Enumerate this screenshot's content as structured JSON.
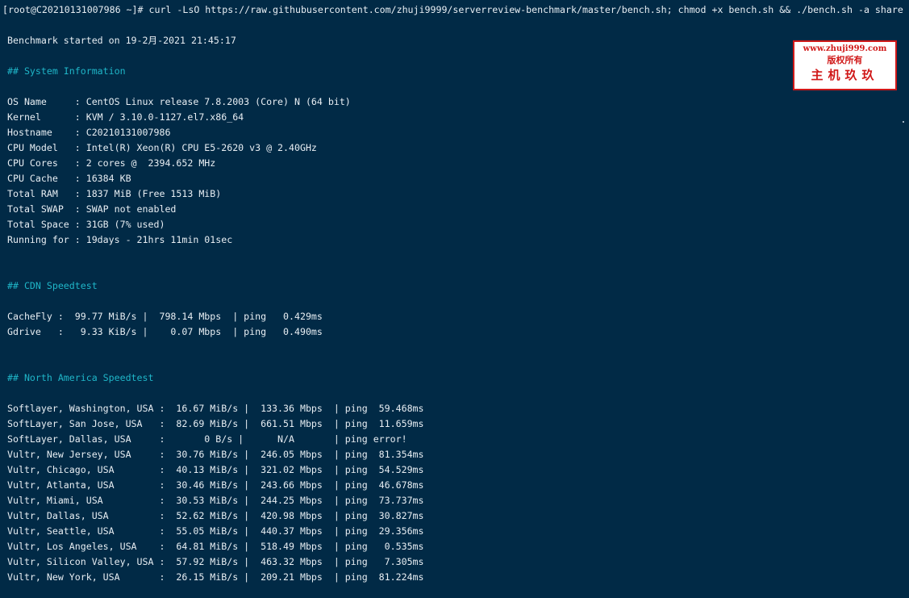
{
  "command": "[root@C20210131007986 ~]# curl -LsO https://raw.githubusercontent.com/zhuji9999/serverreview-benchmark/master/bench.sh; chmod +x bench.sh && ./bench.sh -a share",
  "started": "Benchmark started on 19-2月-2021 21:45:17",
  "sections": {
    "system": "## System Information",
    "cdn": "## CDN Speedtest",
    "na": "## North America Speedtest"
  },
  "system_info": [
    "OS Name     : CentOS Linux release 7.8.2003 (Core) N (64 bit)",
    "Kernel      : KVM / 3.10.0-1127.el7.x86_64",
    "Hostname    : C20210131007986",
    "CPU Model   : Intel(R) Xeon(R) CPU E5-2620 v3 @ 2.40GHz",
    "CPU Cores   : 2 cores @  2394.652 MHz",
    "CPU Cache   : 16384 KB",
    "Total RAM   : 1837 MiB (Free 1513 MiB)",
    "Total SWAP  : SWAP not enabled",
    "Total Space : 31GB (7% used)",
    "Running for : 19days - 21hrs 11min 01sec"
  ],
  "cdn_rows": [
    "CacheFly :  99.77 MiB/s |  798.14 Mbps  | ping   0.429ms",
    "Gdrive   :   9.33 KiB/s |    0.07 Mbps  | ping   0.490ms"
  ],
  "na_rows": [
    "Softlayer, Washington, USA :  16.67 MiB/s |  133.36 Mbps  | ping  59.468ms",
    "SoftLayer, San Jose, USA   :  82.69 MiB/s |  661.51 Mbps  | ping  11.659ms",
    "SoftLayer, Dallas, USA     :       0 B/s |      N/A       | ping error!",
    "Vultr, New Jersey, USA     :  30.76 MiB/s |  246.05 Mbps  | ping  81.354ms",
    "Vultr, Chicago, USA        :  40.13 MiB/s |  321.02 Mbps  | ping  54.529ms",
    "Vultr, Atlanta, USA        :  30.46 MiB/s |  243.66 Mbps  | ping  46.678ms",
    "Vultr, Miami, USA          :  30.53 MiB/s |  244.25 Mbps  | ping  73.737ms",
    "Vultr, Dallas, USA         :  52.62 MiB/s |  420.98 Mbps  | ping  30.827ms",
    "Vultr, Seattle, USA        :  55.05 MiB/s |  440.37 Mbps  | ping  29.356ms",
    "Vultr, Los Angeles, USA    :  64.81 MiB/s |  518.49 Mbps  | ping   0.535ms",
    "Vultr, Silicon Valley, USA :  57.92 MiB/s |  463.32 Mbps  | ping   7.305ms",
    "Vultr, New York, USA       :  26.15 MiB/s |  209.21 Mbps  | ping  81.224ms"
  ],
  "watermark": {
    "url": "www.zhuji999.com",
    "rights": "版权所有",
    "brand": "主机玖玖"
  }
}
